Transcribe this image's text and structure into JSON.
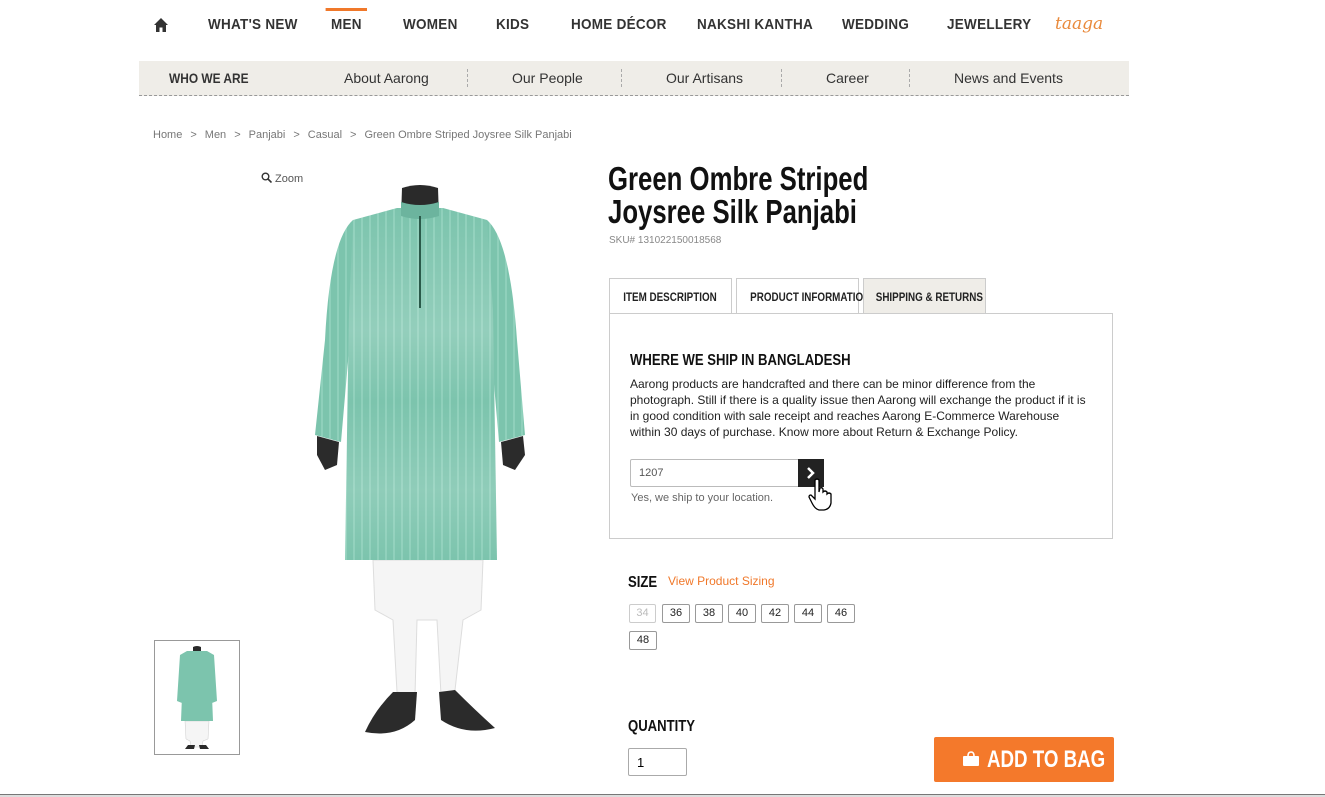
{
  "nav": {
    "items": [
      "WHAT'S NEW",
      "MEN",
      "WOMEN",
      "KIDS",
      "HOME DÉCOR",
      "NAKSHI KANTHA",
      "WEDDING",
      "JEWELLERY"
    ],
    "active": "MEN",
    "logo_text": "taaga",
    "accent_color": "#f0782a"
  },
  "subnav": {
    "title": "WHO WE ARE",
    "links": [
      "About Aarong",
      "Our People",
      "Our Artisans",
      "Career",
      "News and Events"
    ]
  },
  "breadcrumb": [
    "Home",
    "Men",
    "Panjabi",
    "Casual",
    "Green Ombre Striped Joysree Silk Panjabi"
  ],
  "breadcrumb_sep": ">",
  "zoom_label": "Zoom",
  "product": {
    "title_line1": "Green Ombre Striped",
    "title_line2": "Joysree Silk Panjabi",
    "sku": "SKU# 131022150018568"
  },
  "tabs": [
    "ITEM DESCRIPTION",
    "PRODUCT INFORMATION",
    "SHIPPING & RETURNS"
  ],
  "active_tab": "SHIPPING & RETURNS",
  "shipping": {
    "heading": "WHERE WE SHIP IN BANGLADESH",
    "body": "Aarong products are handcrafted and there can be minor difference from the photograph. Still if there is a quality issue then Aarong will exchange the product if it is in good condition with sale receipt and reaches Aarong E-Commerce Warehouse within 30 days of purchase. Know more about Return & Exchange Policy.",
    "zip_value": "1207",
    "zip_message": "Yes, we ship to your location."
  },
  "size": {
    "label": "SIZE",
    "sizing_link": "View Product Sizing",
    "options": [
      "34",
      "36",
      "38",
      "40",
      "42",
      "44",
      "46",
      "48"
    ],
    "disabled": [
      "34"
    ]
  },
  "quantity": {
    "label": "QUANTITY",
    "value": "1"
  },
  "add_to_bag": "ADD TO BAG",
  "colors": {
    "add_button": "#f4792b",
    "garment": "#7cc4ad"
  }
}
